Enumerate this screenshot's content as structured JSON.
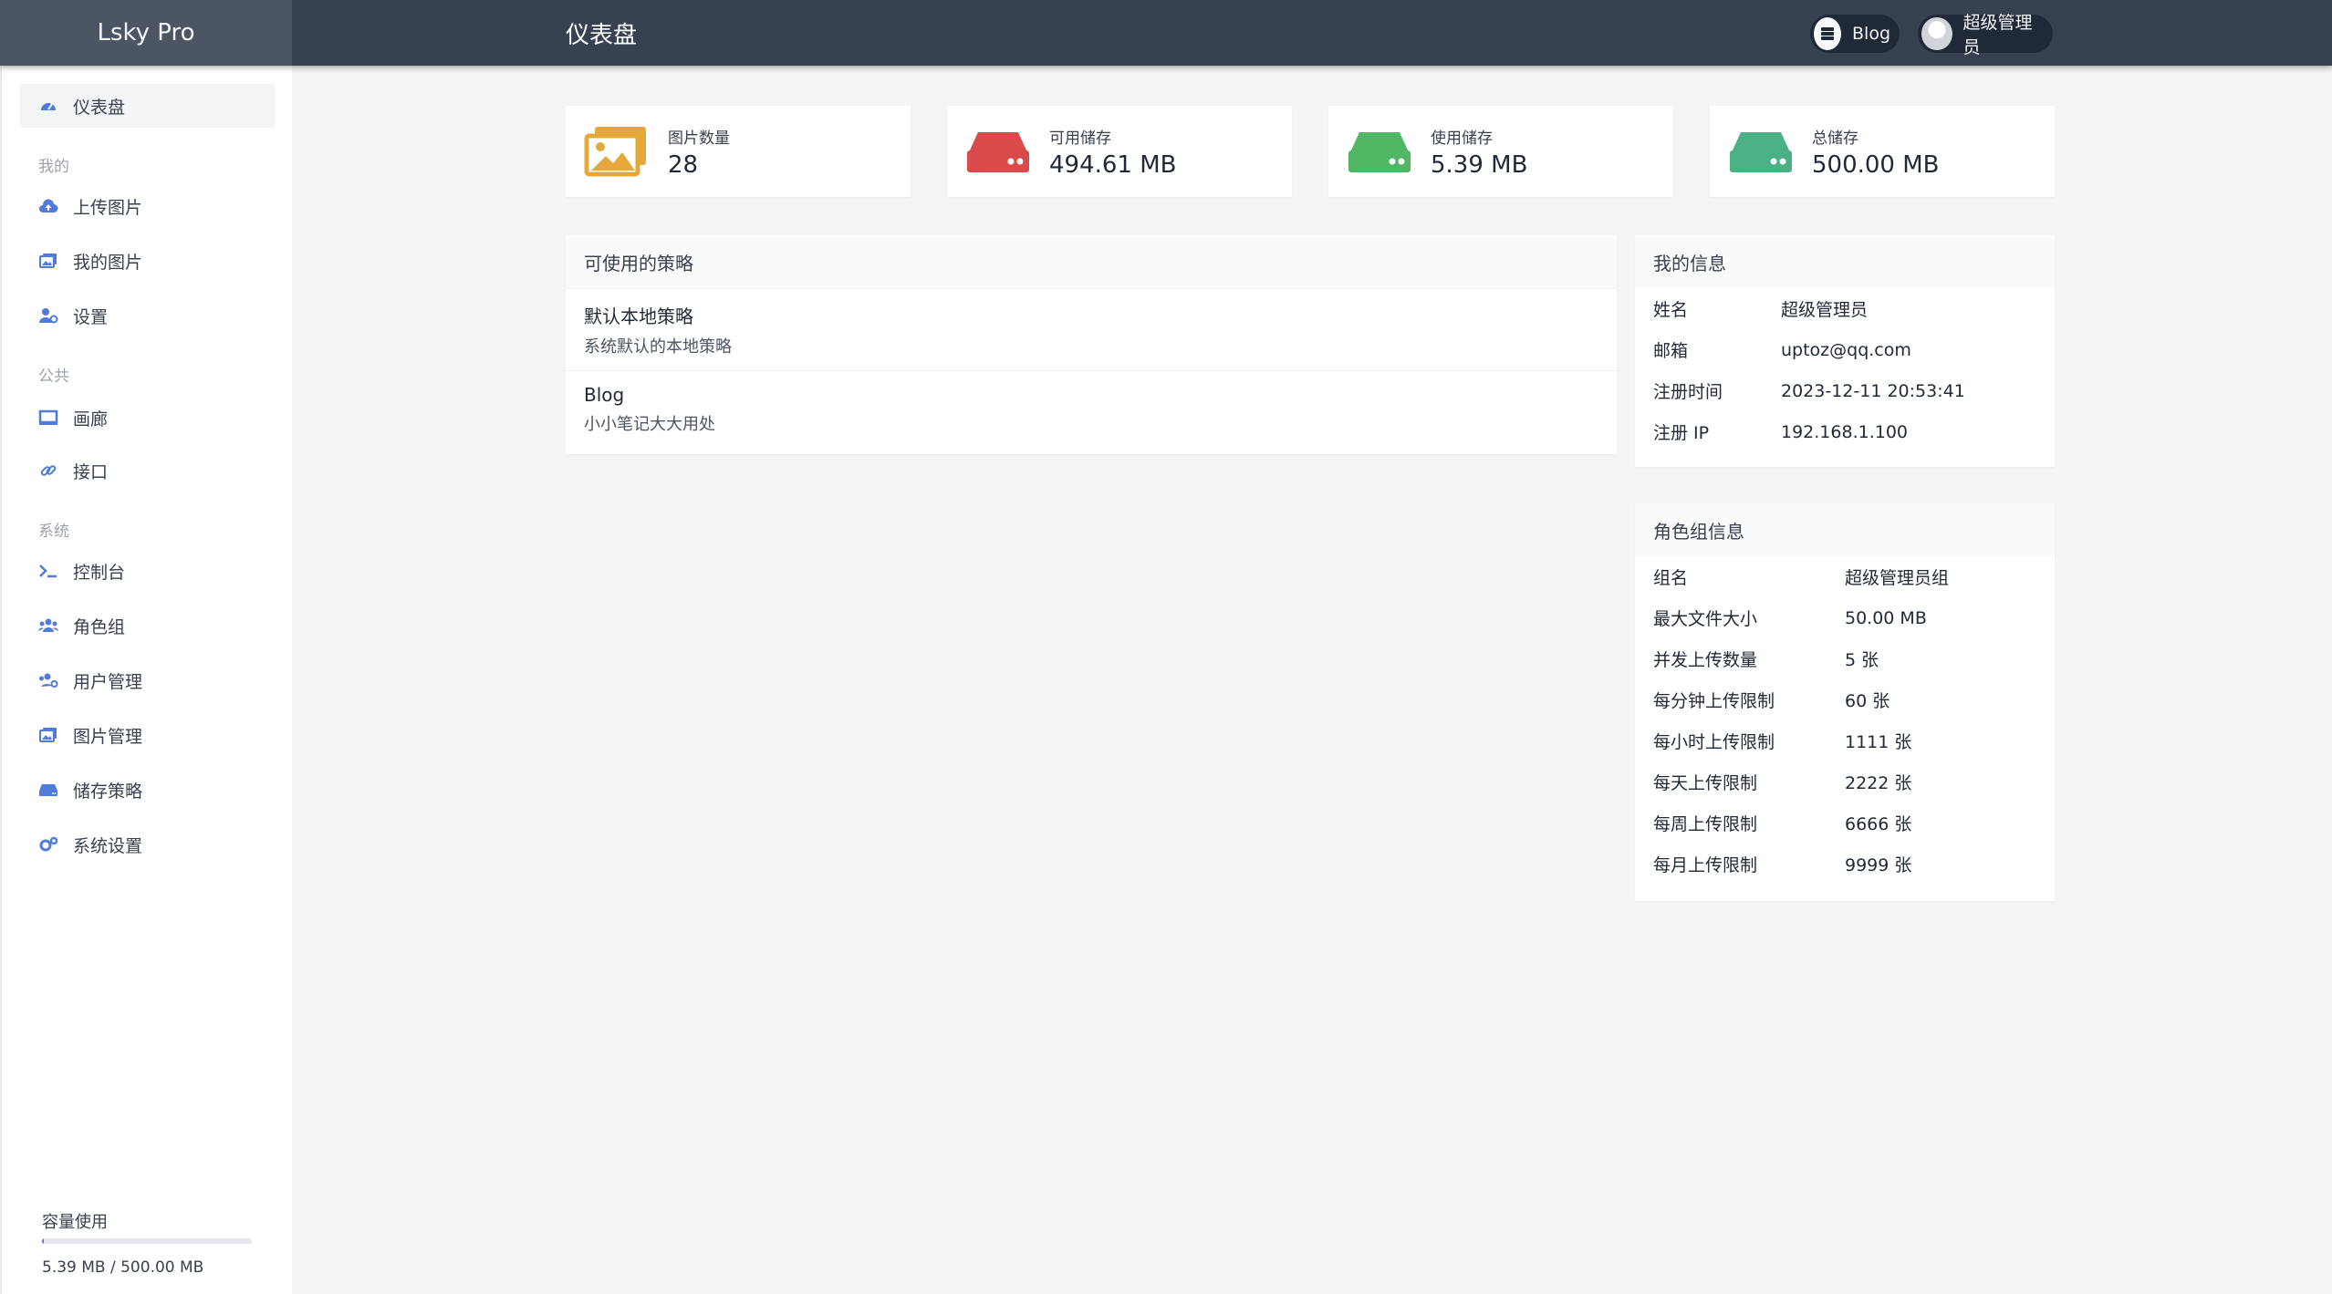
{
  "header": {
    "brand": "Lsky Pro",
    "title": "仪表盘",
    "blog_label": "Blog",
    "user_label": "超级管理员"
  },
  "sidebar": {
    "dashboard": "仪表盘",
    "section_mine": "我的",
    "upload": "上传图片",
    "my_images": "我的图片",
    "settings": "设置",
    "section_public": "公共",
    "gallery": "画廊",
    "api": "接口",
    "section_system": "系统",
    "console": "控制台",
    "roles": "角色组",
    "users": "用户管理",
    "image_mgmt": "图片管理",
    "storage": "储存策略",
    "system_settings": "系统设置",
    "usage_label": "容量使用",
    "usage_text": "5.39 MB / 500.00 MB",
    "usage_fraction": 0.0108
  },
  "stats": [
    {
      "label": "图片数量",
      "value": "28",
      "icon": "images-icon",
      "color": "#e5a83b"
    },
    {
      "label": "可用储存",
      "value": "494.61 MB",
      "icon": "hdd-icon",
      "color": "#d94a4a"
    },
    {
      "label": "使用储存",
      "value": "5.39 MB",
      "icon": "hdd-icon",
      "color": "#52b765"
    },
    {
      "label": "总储存",
      "value": "500.00 MB",
      "icon": "hdd-icon",
      "color": "#4bb083"
    }
  ],
  "strategies": {
    "title": "可使用的策略",
    "items": [
      {
        "name": "默认本地策略",
        "desc": "系统默认的本地策略"
      },
      {
        "name": "Blog",
        "desc": "小小笔记大大用处"
      }
    ]
  },
  "my_info": {
    "title": "我的信息",
    "rows": [
      {
        "key": "姓名",
        "value": "超级管理员"
      },
      {
        "key": "邮箱",
        "value": "uptoz@qq.com"
      },
      {
        "key": "注册时间",
        "value": "2023-12-11 20:53:41"
      },
      {
        "key": "注册 IP",
        "value": "192.168.1.100"
      }
    ]
  },
  "role_info": {
    "title": "角色组信息",
    "rows": [
      {
        "key": "组名",
        "value": "超级管理员组"
      },
      {
        "key": "最大文件大小",
        "value": "50.00 MB"
      },
      {
        "key": "并发上传数量",
        "value": "5 张"
      },
      {
        "key": "每分钟上传限制",
        "value": "60 张"
      },
      {
        "key": "每小时上传限制",
        "value": "1111 张"
      },
      {
        "key": "每天上传限制",
        "value": "2222 张"
      },
      {
        "key": "每周上传限制",
        "value": "6666 张"
      },
      {
        "key": "每月上传限制",
        "value": "9999 张"
      }
    ]
  }
}
